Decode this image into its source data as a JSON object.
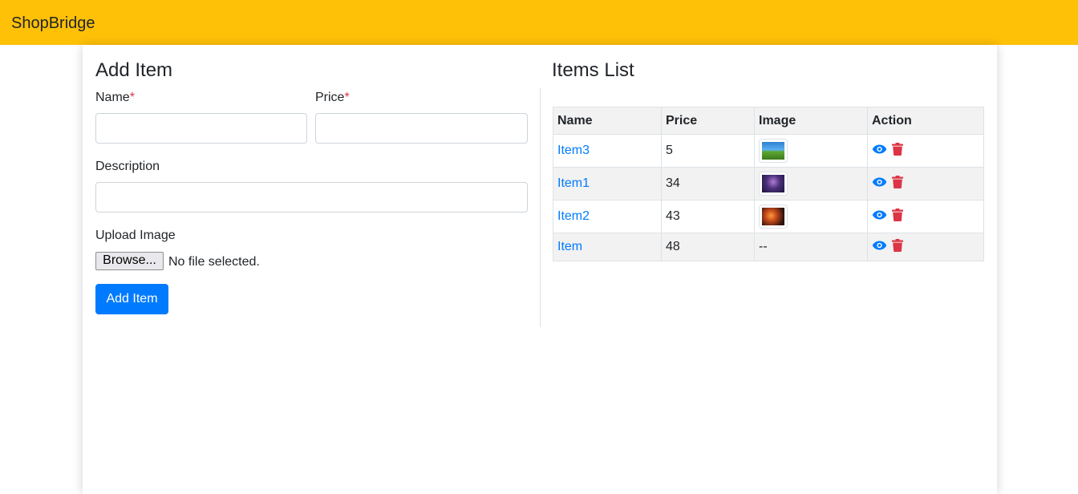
{
  "navbar": {
    "brand": "ShopBridge"
  },
  "form": {
    "title": "Add Item",
    "name_label": "Name",
    "price_label": "Price",
    "required_mark": "*",
    "description_label": "Description",
    "upload_label": "Upload Image",
    "browse_label": "Browse...",
    "file_status": "No file selected.",
    "submit_label": "Add Item"
  },
  "list": {
    "title": "Items List",
    "columns": [
      "Name",
      "Price",
      "Image",
      "Action"
    ],
    "rows": [
      {
        "name": "Item3",
        "price": "5",
        "image": "landscape-thumbnail"
      },
      {
        "name": "Item1",
        "price": "34",
        "image": "galaxy-thumbnail"
      },
      {
        "name": "Item2",
        "price": "43",
        "image": "fireworks-thumbnail"
      },
      {
        "name": "Item",
        "price": "48",
        "image_placeholder": "--"
      }
    ]
  },
  "colors": {
    "navbar_bg": "#ffc107",
    "primary": "#007bff",
    "danger": "#dc3545"
  },
  "icons": {
    "view": "eye-icon",
    "delete": "trash-icon"
  }
}
